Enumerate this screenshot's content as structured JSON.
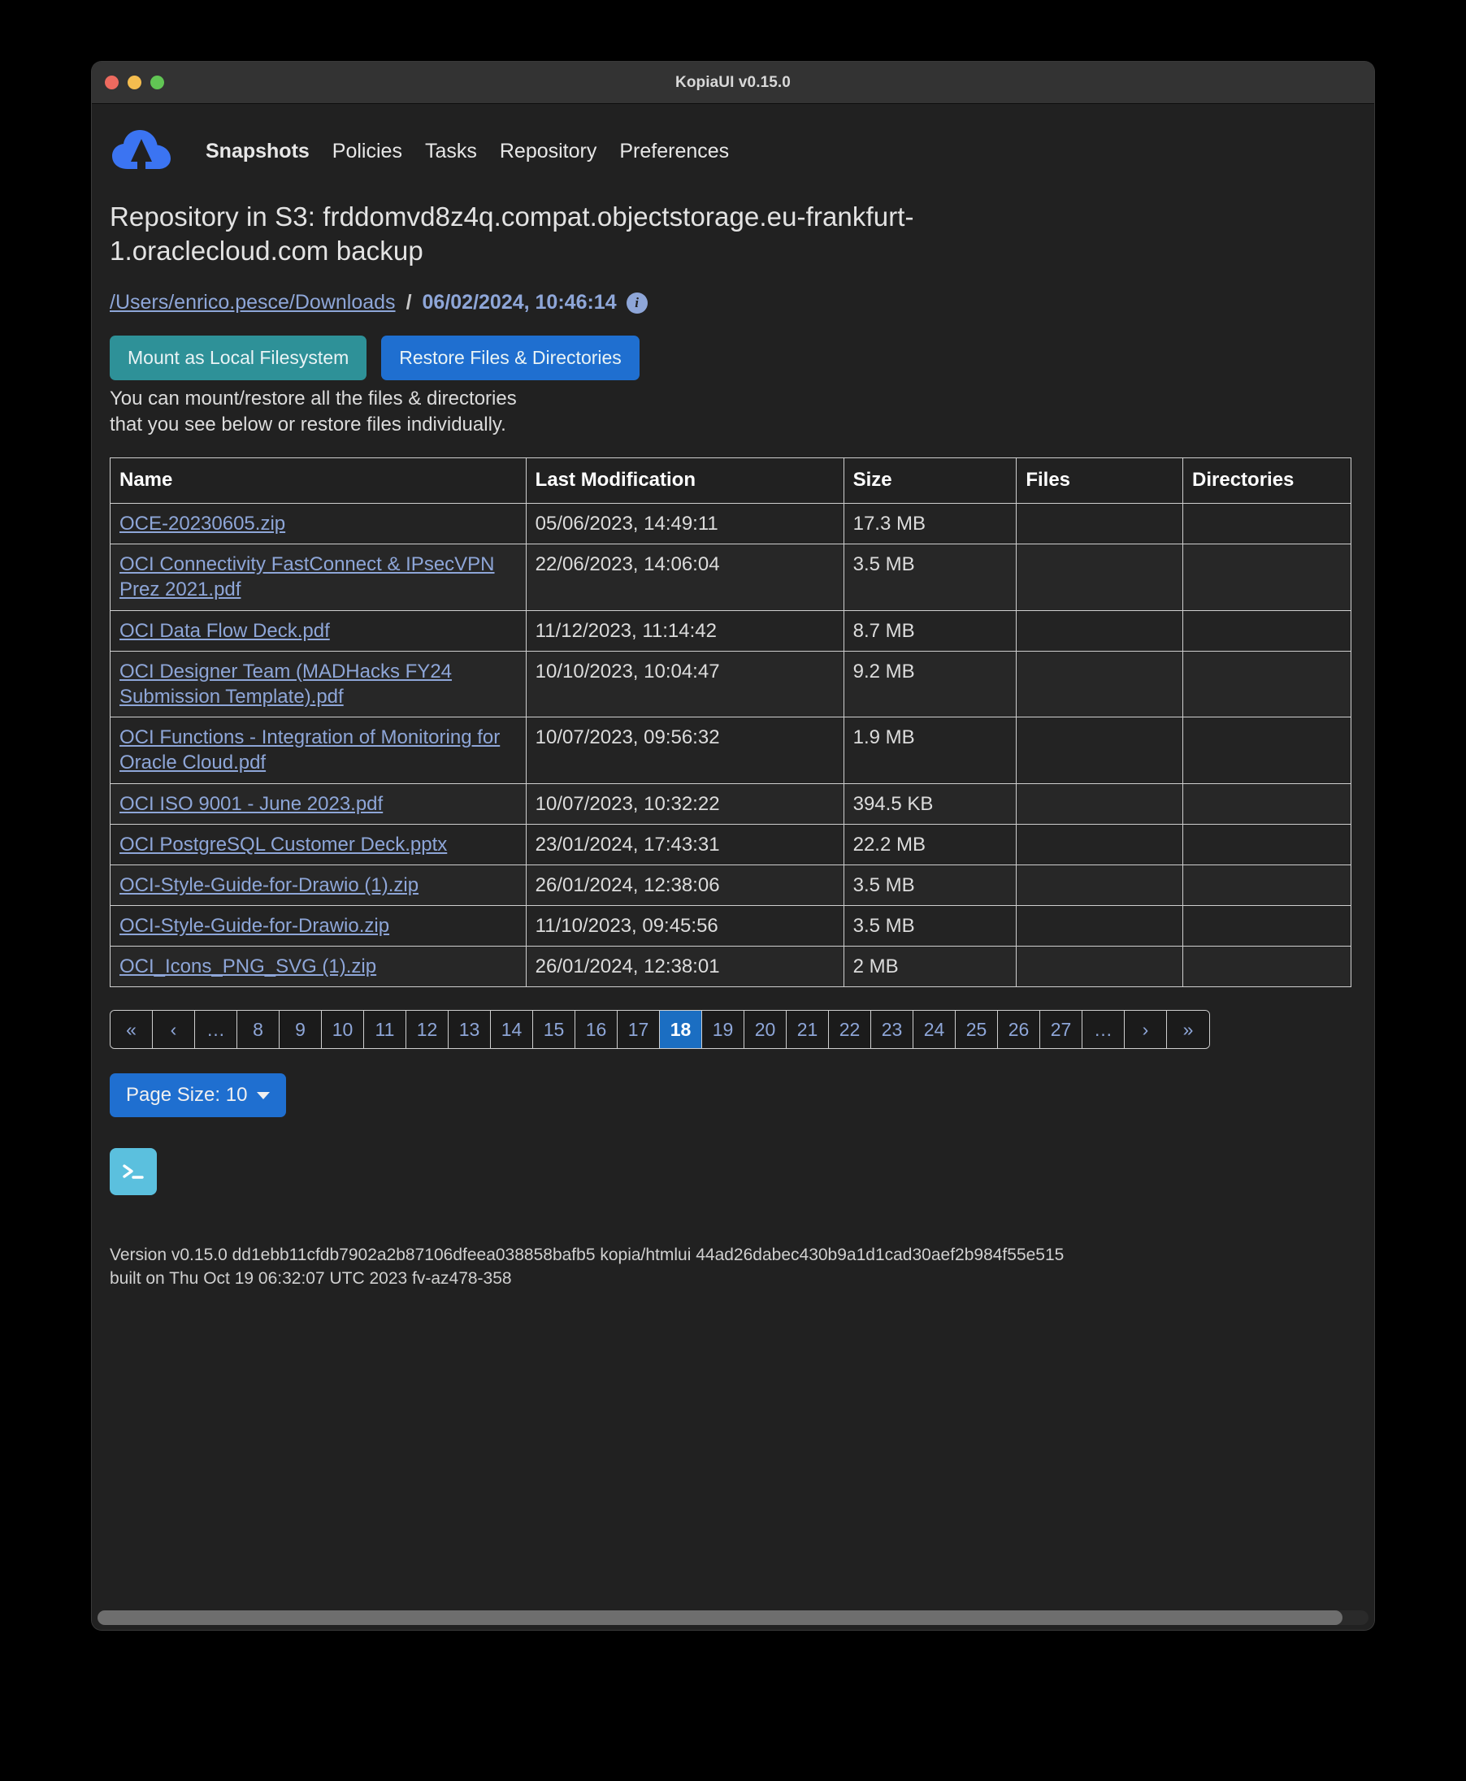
{
  "window": {
    "title": "KopiaUI v0.15.0",
    "traffic_lights": [
      "close",
      "minimize",
      "zoom"
    ]
  },
  "navbar": {
    "logo_name": "kopia-cloud-logo",
    "items": [
      {
        "label": "Snapshots",
        "active": true
      },
      {
        "label": "Policies",
        "active": false
      },
      {
        "label": "Tasks",
        "active": false
      },
      {
        "label": "Repository",
        "active": false
      },
      {
        "label": "Preferences",
        "active": false
      }
    ]
  },
  "page": {
    "repo_title": "Repository in S3: frddomvd8z4q.compat.objectstorage.eu-frankfurt-1.oraclecloud.com backup",
    "breadcrumb": {
      "path": "/Users/enrico.pesce/Downloads",
      "separator": "/",
      "timestamp": "06/02/2024, 10:46:14",
      "info_glyph": "i"
    },
    "actions": {
      "mount_label": "Mount as Local Filesystem",
      "restore_label": "Restore Files & Directories",
      "hint_line1": "You can mount/restore all the files & directories",
      "hint_line2": "that you see below or restore files individually."
    }
  },
  "table": {
    "columns": [
      "Name",
      "Last Modification",
      "Size",
      "Files",
      "Directories"
    ],
    "rows": [
      {
        "name": "OCE-20230605.zip",
        "modified": "05/06/2023, 14:49:11",
        "size": "17.3 MB",
        "files": "",
        "directories": ""
      },
      {
        "name": "OCI Connectivity FastConnect & IPsecVPN Prez 2021.pdf",
        "modified": "22/06/2023, 14:06:04",
        "size": "3.5 MB",
        "files": "",
        "directories": ""
      },
      {
        "name": "OCI Data Flow Deck.pdf",
        "modified": "11/12/2023, 11:14:42",
        "size": "8.7 MB",
        "files": "",
        "directories": ""
      },
      {
        "name": "OCI Designer Team (MADHacks FY24 Submission Template).pdf",
        "modified": "10/10/2023, 10:04:47",
        "size": "9.2 MB",
        "files": "",
        "directories": ""
      },
      {
        "name": "OCI Functions - Integration of Monitoring for Oracle Cloud.pdf",
        "modified": "10/07/2023, 09:56:32",
        "size": "1.9 MB",
        "files": "",
        "directories": ""
      },
      {
        "name": "OCI ISO 9001 - June 2023.pdf",
        "modified": "10/07/2023, 10:32:22",
        "size": "394.5 KB",
        "files": "",
        "directories": ""
      },
      {
        "name": "OCI PostgreSQL Customer Deck.pptx",
        "modified": "23/01/2024, 17:43:31",
        "size": "22.2 MB",
        "files": "",
        "directories": ""
      },
      {
        "name": "OCI-Style-Guide-for-Drawio (1).zip",
        "modified": "26/01/2024, 12:38:06",
        "size": "3.5 MB",
        "files": "",
        "directories": ""
      },
      {
        "name": "OCI-Style-Guide-for-Drawio.zip",
        "modified": "11/10/2023, 09:45:56",
        "size": "3.5 MB",
        "files": "",
        "directories": ""
      },
      {
        "name": "OCI_Icons_PNG_SVG (1).zip",
        "modified": "26/01/2024, 12:38:01",
        "size": "2 MB",
        "files": "",
        "directories": ""
      }
    ]
  },
  "pagination": {
    "current": "18",
    "items": [
      {
        "label": "«",
        "name": "first-page"
      },
      {
        "label": "‹",
        "name": "prev-page"
      },
      {
        "label": "…",
        "name": "ellipsis-left"
      },
      {
        "label": "8",
        "name": "page-8"
      },
      {
        "label": "9",
        "name": "page-9"
      },
      {
        "label": "10",
        "name": "page-10"
      },
      {
        "label": "11",
        "name": "page-11"
      },
      {
        "label": "12",
        "name": "page-12"
      },
      {
        "label": "13",
        "name": "page-13"
      },
      {
        "label": "14",
        "name": "page-14"
      },
      {
        "label": "15",
        "name": "page-15"
      },
      {
        "label": "16",
        "name": "page-16"
      },
      {
        "label": "17",
        "name": "page-17"
      },
      {
        "label": "18",
        "name": "page-18"
      },
      {
        "label": "19",
        "name": "page-19"
      },
      {
        "label": "20",
        "name": "page-20"
      },
      {
        "label": "21",
        "name": "page-21"
      },
      {
        "label": "22",
        "name": "page-22"
      },
      {
        "label": "23",
        "name": "page-23"
      },
      {
        "label": "24",
        "name": "page-24"
      },
      {
        "label": "25",
        "name": "page-25"
      },
      {
        "label": "26",
        "name": "page-26"
      },
      {
        "label": "27",
        "name": "page-27"
      },
      {
        "label": "…",
        "name": "ellipsis-right"
      },
      {
        "label": "›",
        "name": "next-page"
      },
      {
        "label": "»",
        "name": "last-page"
      }
    ]
  },
  "page_size": {
    "label": "Page Size: 10",
    "value": "10"
  },
  "terminal_button": {
    "icon_name": "terminal-icon",
    "glyph": ">_"
  },
  "footer": {
    "line1": "Version v0.15.0 dd1ebb11cfdb7902a2b87106dfeea038858bafb5 kopia/htmlui 44ad26dabec430b9a1d1cad30aef2b984f55e515",
    "line2": "built on Thu Oct 19 06:32:07 UTC 2023 fv-az478-358"
  },
  "colors": {
    "accent_blue": "#1f6fd0",
    "teal": "#2e9198",
    "link_blue": "#8ea6d8",
    "terminal_blue": "#5bc0de",
    "window_bg": "#212121",
    "titlebar_bg": "#333333"
  }
}
